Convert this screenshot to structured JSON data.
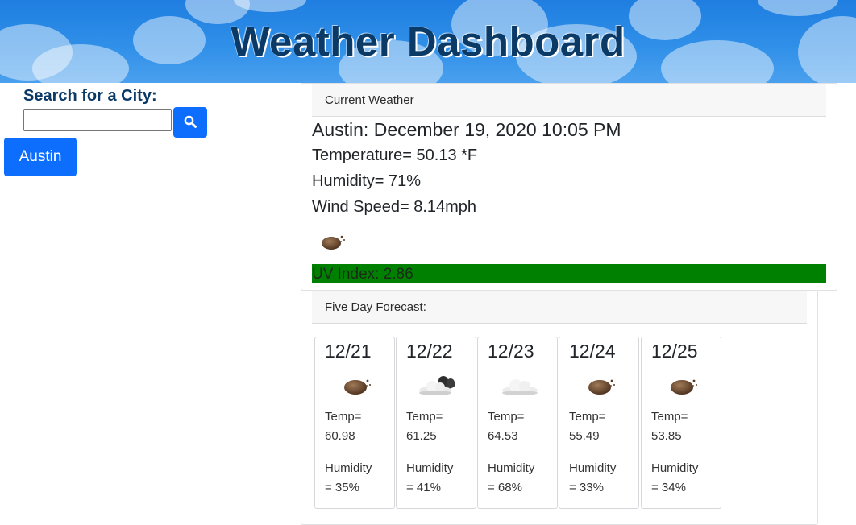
{
  "header": {
    "title": "Weather Dashboard"
  },
  "sidebar": {
    "search_label": "Search for a City:",
    "search_value": "",
    "search_button_icon": "search-icon",
    "history": [
      {
        "label": "Austin"
      }
    ]
  },
  "current": {
    "header": "Current Weather",
    "title": "Austin: December 19, 2020 10:05 PM",
    "temperature": "Temperature= 50.13 *F",
    "humidity": "Humidity= 71%",
    "wind": "Wind Speed= 8.14mph",
    "icon": "night-clear-icon",
    "uv": "UV Index: 2.86",
    "uv_color": "#008000"
  },
  "forecast": {
    "header": "Five Day Forecast:",
    "days": [
      {
        "date": "12/21",
        "icon": "night-clear-icon",
        "temp_label": "Temp=",
        "temp": "60.98",
        "hum_label": "Humidity",
        "hum": "= 35%"
      },
      {
        "date": "12/22",
        "icon": "dark-cloud-icon",
        "temp_label": "Temp=",
        "temp": "61.25",
        "hum_label": "Humidity",
        "hum": "= 41%"
      },
      {
        "date": "12/23",
        "icon": "cloud-icon",
        "temp_label": "Temp=",
        "temp": "64.53",
        "hum_label": "Humidity",
        "hum": "= 68%"
      },
      {
        "date": "12/24",
        "icon": "night-clear-icon",
        "temp_label": "Temp=",
        "temp": "55.49",
        "hum_label": "Humidity",
        "hum": "= 33%"
      },
      {
        "date": "12/25",
        "icon": "night-clear-icon",
        "temp_label": "Temp=",
        "temp": "53.85",
        "hum_label": "Humidity",
        "hum": "= 34%"
      }
    ]
  },
  "colors": {
    "accent": "#0d6efd",
    "title": "#0b3a66",
    "header_sky": "#2f8fe8"
  }
}
